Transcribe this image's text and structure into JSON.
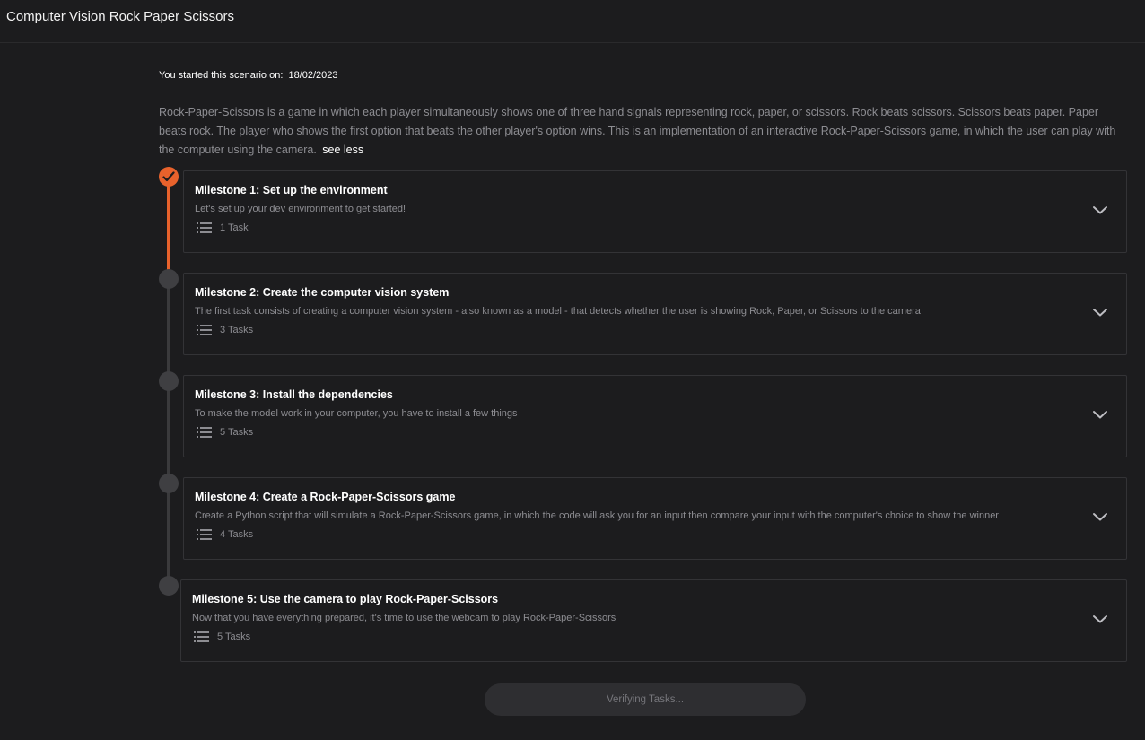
{
  "app": {
    "title": "Computer Vision Rock Paper Scissors"
  },
  "scenario": {
    "started_label": "You started this scenario on:",
    "started_date": "18/02/2023",
    "description": "Rock-Paper-Scissors is a game in which each player simultaneously shows one of three hand signals representing rock, paper, or scissors. Rock beats scissors. Scissors beats paper. Paper beats rock. The player who shows the first option that beats the other player's option wins. This is an implementation of an interactive Rock-Paper-Scissors game, in which the user can play with the computer using the camera.",
    "toggle_label": "see less"
  },
  "milestones": [
    {
      "title": "Milestone 1: Set up the environment",
      "subtitle": "Let's set up your dev environment to get started!",
      "tasks": "1 Task",
      "status": "completed"
    },
    {
      "title": "Milestone 2: Create the computer vision system",
      "subtitle": "The first task consists of creating a computer vision system - also known as a model - that detects whether the user is showing Rock, Paper, or Scissors to the camera",
      "tasks": "3 Tasks",
      "status": "pending"
    },
    {
      "title": "Milestone 3: Install the dependencies",
      "subtitle": "To make the model work in your computer, you have to install a few things",
      "tasks": "5 Tasks",
      "status": "pending"
    },
    {
      "title": "Milestone 4: Create a Rock-Paper-Scissors game",
      "subtitle": "Create a Python script that will simulate a Rock-Paper-Scissors game, in which the code will ask you for an input then compare your input with the computer's choice to show the winner",
      "tasks": "4 Tasks",
      "status": "pending"
    },
    {
      "title": "Milestone 5: Use the camera to play Rock-Paper-Scissors",
      "subtitle": "Now that you have everything prepared, it's time to use the webcam to play Rock-Paper-Scissors",
      "tasks": "5 Tasks",
      "status": "pending"
    }
  ],
  "footer": {
    "verify_label": "Verifying Tasks..."
  },
  "colors": {
    "accent": "#e8622c",
    "background": "#1c1c1e",
    "pending_dot": "#3f3f42"
  },
  "icons": {
    "completed": "checkmark-icon",
    "tasks": "list-icon",
    "expand": "chevron-down-icon"
  }
}
